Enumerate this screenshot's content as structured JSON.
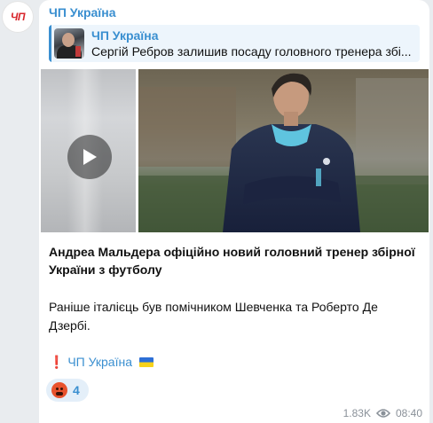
{
  "channel": {
    "avatar_text": "ЧП",
    "name": "ЧП Україна",
    "brand_color": "#d8262c"
  },
  "reply": {
    "author": "ЧП Україна",
    "text": "Сергій Ребров залишив посаду головного тренера збі..."
  },
  "media": {
    "left_icon": "play-icon",
    "right_description_color": "#3a8fd0"
  },
  "message": {
    "caption": "Андреа Мальдера офіційно новий головний тренер збірної України з футболу",
    "body": "Раніше італієць був помічником Шевченка та Роберто Де Дзербі.",
    "signature_prefix": "❗",
    "signature_link": "ЧП Україна"
  },
  "reaction": {
    "emoji": "enraged-face-icon",
    "count": "4"
  },
  "footer": {
    "views": "1.83K",
    "time": "08:40"
  },
  "colors": {
    "accent": "#3a8fd0",
    "bubble_bg": "#ffffff",
    "chat_bg": "#e9ecef"
  }
}
